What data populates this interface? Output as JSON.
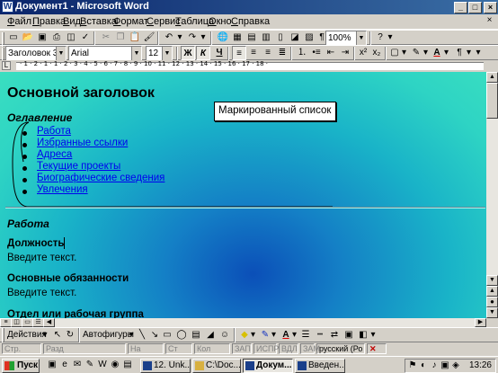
{
  "window": {
    "title": "Документ1 - Microsoft Word"
  },
  "menu": {
    "items": [
      "Файл",
      "Правка",
      "Вид",
      "Вставка",
      "Формат",
      "Сервис",
      "Таблица",
      "Окно",
      "Справка"
    ],
    "close_glyph": "×"
  },
  "standard_toolbar": {
    "zoom": "100%"
  },
  "formatting_toolbar": {
    "style": "Заголовок 3",
    "font": "Arial",
    "size": "12",
    "bold": "Ж",
    "italic": "К",
    "underline": "Ч"
  },
  "ruler": {
    "numbers": "· 1 · 2 · 1 · 1 · 2 · 3 · 4 · 5 · 6 · 7 · 8 · 9 · 10 · 11 · 12 · 13 · 14 · 15 · 16 · 17 · 18 ·"
  },
  "document": {
    "heading": "Основной заголовок",
    "toc_title": "Оглавление",
    "toc_items": [
      "Работа",
      "Избранные ссылки",
      "Адреса",
      "Текущие проекты",
      "Биографические сведения",
      "Увлечения"
    ],
    "section_title": "Работа",
    "sub1": "Должность",
    "body1": "Введите текст.",
    "sub2": "Основные обязанности",
    "body2": "Введите текст.",
    "sub3": "Отдел или рабочая группа",
    "callout": "Маркированный список"
  },
  "drawing_toolbar": {
    "actions": "Действия",
    "autoshapes": "Автофигуры"
  },
  "status_bar": {
    "fields": [
      "Стр.",
      "Разд",
      "На",
      "Ст",
      "Кол",
      "ЗАП",
      "ИСПР",
      "ВДЛ",
      "ЗАМ"
    ],
    "language": "русский (Ро"
  },
  "taskbar": {
    "start": "Пуск",
    "tasks": [
      "12. Unk...",
      "C:\\Doc...",
      "Докум...",
      "Введен..."
    ],
    "clock": "13:26"
  },
  "colors": {
    "titlebar_start": "#0a246a",
    "titlebar_end": "#3a6ea5",
    "link": "#0000ee",
    "doc_background_center": "#0b4fb8",
    "doc_background_edge": "#3adfc0"
  }
}
